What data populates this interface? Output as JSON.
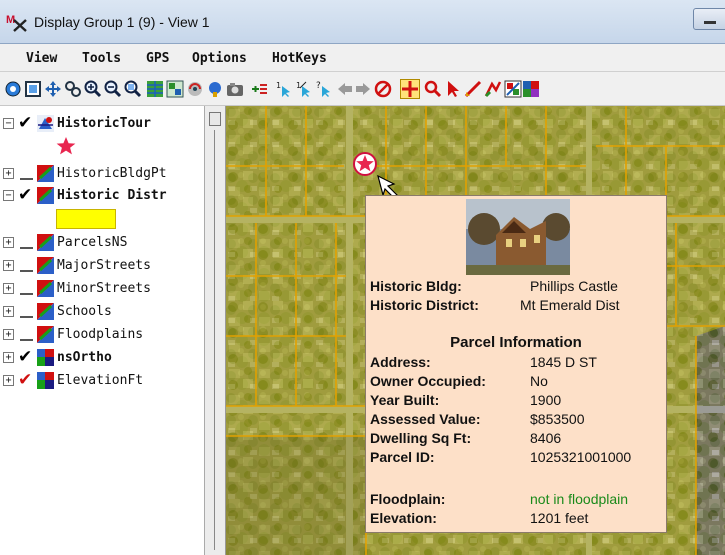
{
  "window": {
    "title": "Display Group 1 (9) - View 1"
  },
  "menubar": {
    "items": [
      "View",
      "Tools",
      "GPS",
      "Options",
      "HotKeys"
    ]
  },
  "toolbar": {
    "tools": [
      "view-all-icon",
      "zoom-box-icon",
      "pan-icon",
      "fit-icon",
      "zoom-in-icon",
      "zoom-out-icon",
      "zoom-area-icon",
      "layers-icon",
      "select-icon",
      "redraw-icon",
      "gps-icon",
      "camera-icon",
      "add-layer-icon",
      "step1-icon",
      "step2-icon",
      "help-icon",
      "back-icon",
      "forward-icon",
      "stop-icon",
      "crosshair-icon",
      "zoom-tool-icon",
      "pointer-icon",
      "measure-icon",
      "sketch-icon",
      "legend-icon",
      "raster-icon"
    ]
  },
  "layers": [
    {
      "label": "HistoricTour",
      "checked": true,
      "bold": true,
      "icon": "tour-icon"
    },
    {
      "label": "HistoricBldgPt",
      "checked": false,
      "bold": false,
      "icon": "vector-layer-icon"
    },
    {
      "label": "Historic Distr",
      "checked": true,
      "bold": true,
      "icon": "vector-layer-icon"
    },
    {
      "label": "ParcelsNS",
      "checked": false,
      "bold": false,
      "icon": "vector-layer-icon"
    },
    {
      "label": "MajorStreets",
      "checked": false,
      "bold": false,
      "icon": "vector-layer-icon"
    },
    {
      "label": "MinorStreets",
      "checked": false,
      "bold": false,
      "icon": "vector-layer-icon"
    },
    {
      "label": "Schools",
      "checked": false,
      "bold": false,
      "icon": "vector-layer-icon"
    },
    {
      "label": "Floodplains",
      "checked": false,
      "bold": false,
      "icon": "vector-layer-icon"
    },
    {
      "label": "nsOrtho",
      "checked": true,
      "bold": true,
      "icon": "raster-layer-icon"
    },
    {
      "label": "ElevationFt",
      "checked": true,
      "bold": false,
      "icon": "raster-layer-icon"
    }
  ],
  "popup": {
    "top": [
      {
        "key": "Historic Bldg:",
        "value": "Phillips Castle"
      },
      {
        "key": "Historic District:",
        "value": "Mt Emerald Dist"
      }
    ],
    "section_title": "Parcel Information",
    "parcel": [
      {
        "key": "Address:",
        "value": "1845 D ST"
      },
      {
        "key": "Owner Occupied:",
        "value": "No"
      },
      {
        "key": "Year Built:",
        "value": "1900"
      },
      {
        "key": "Assessed Value:",
        "value": "$853500"
      },
      {
        "key": "Dwelling Sq Ft:",
        "value": "8406"
      },
      {
        "key": "Parcel ID:",
        "value": "1025321001000"
      }
    ],
    "bottom": [
      {
        "key": "Floodplain:",
        "value": "not in floodplain"
      },
      {
        "key": "Elevation:",
        "value": "1201 feet"
      }
    ]
  },
  "colors": {
    "district_fill": "#ffff00",
    "star": "#e8264f",
    "floodplain_value": "#1a8a1a",
    "popup_bg": "#fde0c8"
  }
}
